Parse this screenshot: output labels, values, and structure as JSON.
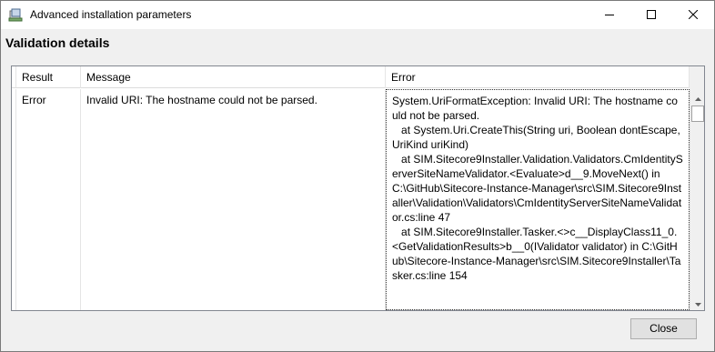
{
  "window": {
    "title": "Advanced installation parameters",
    "app_icon": "installer-icon"
  },
  "titlebar_buttons": {
    "minimize_icon": "minimize-icon",
    "maximize_icon": "maximize-icon",
    "close_icon": "close-icon"
  },
  "heading": "Validation details",
  "table": {
    "columns": [
      "Result",
      "Message",
      "Error"
    ],
    "rows": [
      {
        "result": "Error",
        "message": "Invalid URI: The hostname could not be parsed.",
        "error": "System.UriFormatException: Invalid URI: The hostname could not be parsed.\n   at System.Uri.CreateThis(String uri, Boolean dontEscape, UriKind uriKind)\n   at SIM.Sitecore9Installer.Validation.Validators.CmIdentityServerSiteNameValidator.<Evaluate>d__9.MoveNext() in C:\\GitHub\\Sitecore-Instance-Manager\\src\\SIM.Sitecore9Installer\\Validation\\Validators\\CmIdentityServerSiteNameValidator.cs:line 47\n   at SIM.Sitecore9Installer.Tasker.<>c__DisplayClass11_0.<GetValidationResults>b__0(IValidator validator) in C:\\GitHub\\Sitecore-Instance-Manager\\src\\SIM.Sitecore9Installer\\Tasker.cs:line 154"
      }
    ]
  },
  "buttons": {
    "close_label": "Close"
  }
}
